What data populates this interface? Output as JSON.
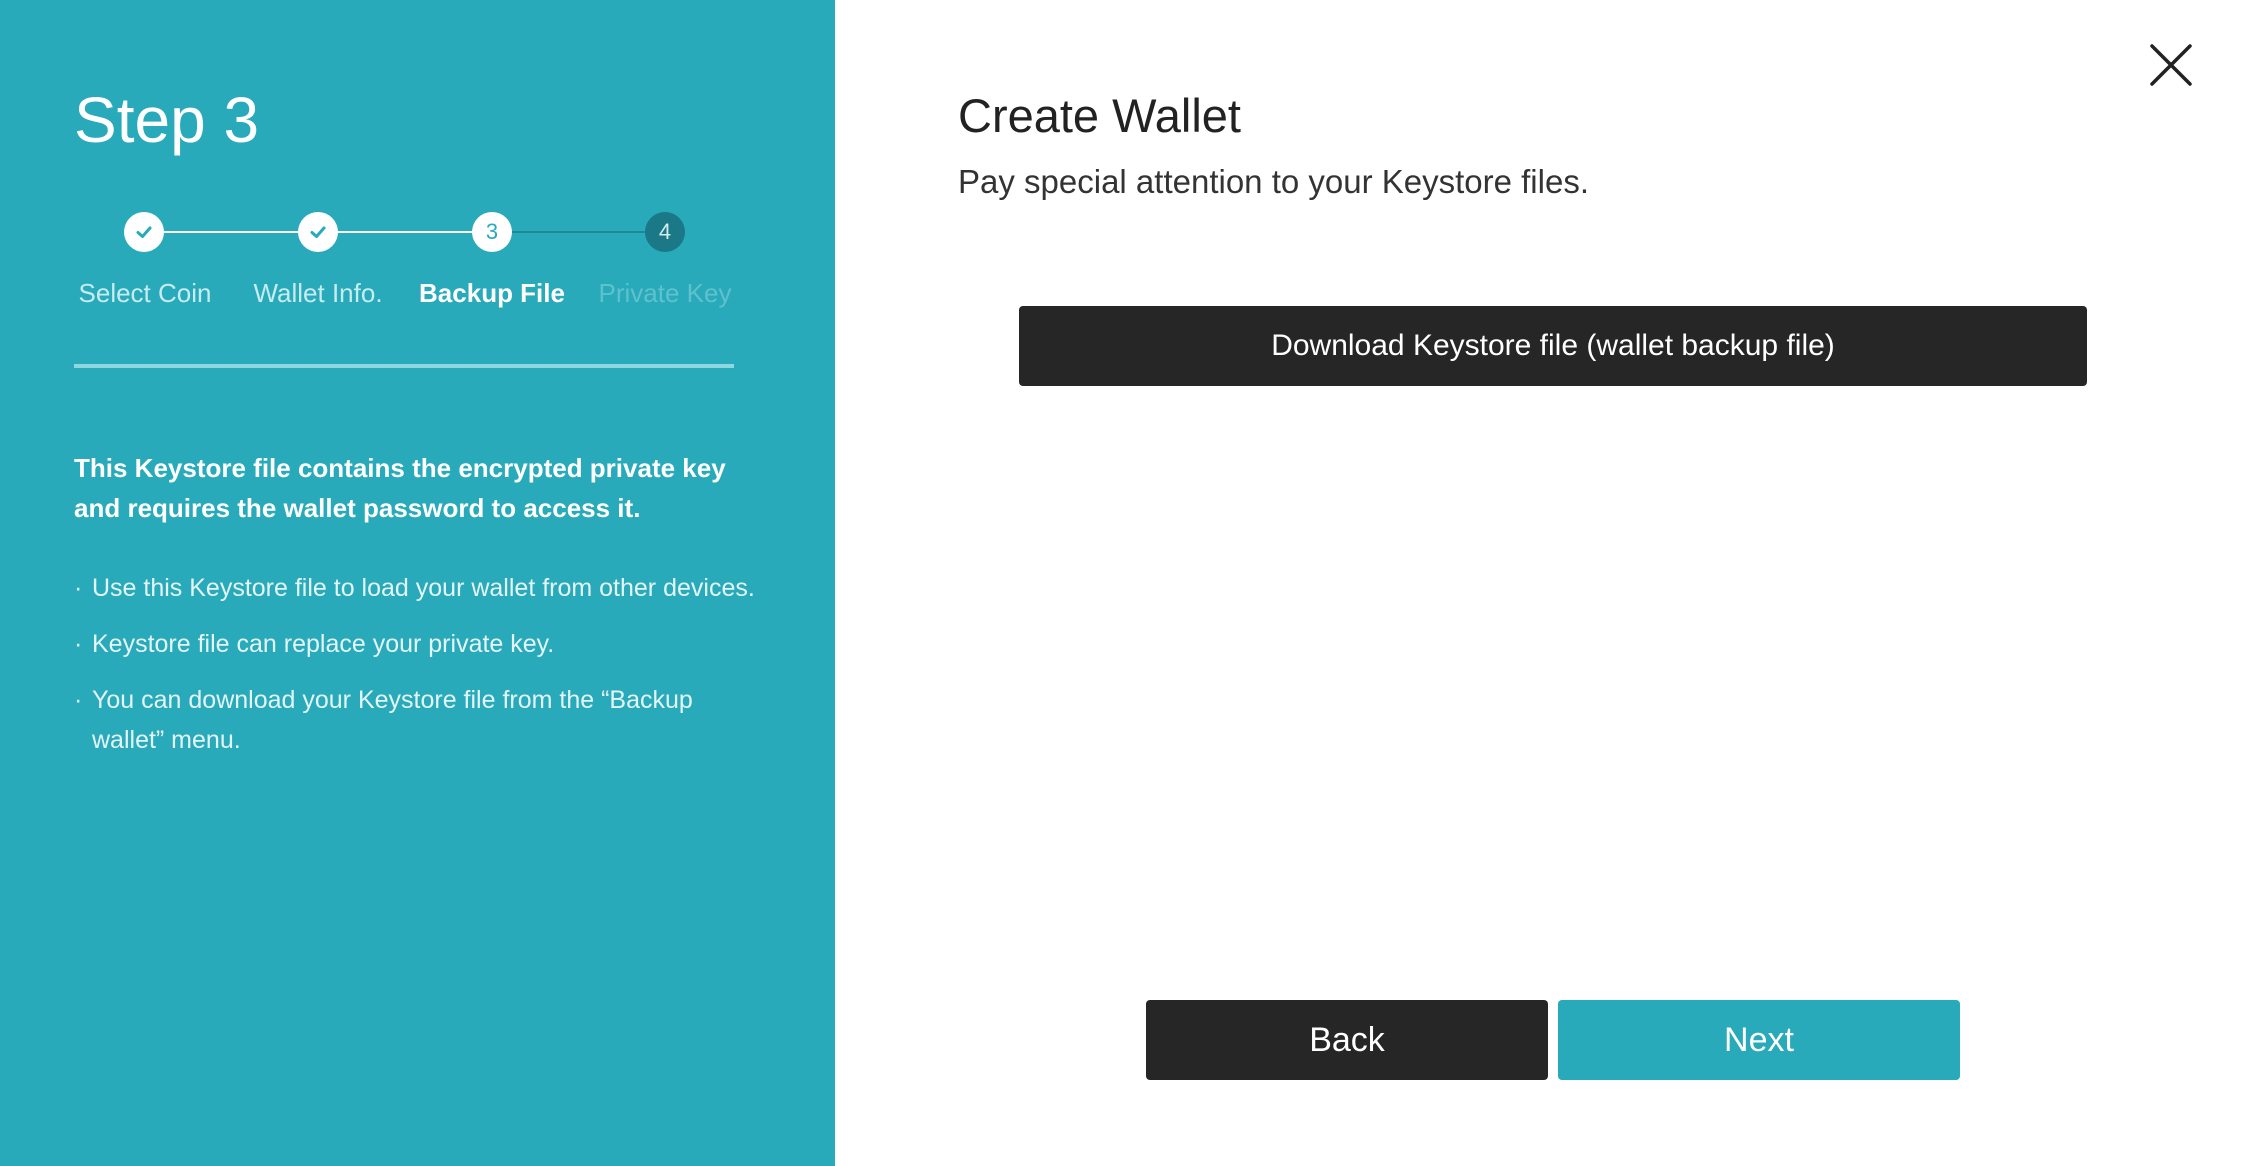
{
  "sidebar": {
    "step_title": "Step 3",
    "steps": [
      {
        "number": "1",
        "label": "Select Coin",
        "status": "complete"
      },
      {
        "number": "2",
        "label": "Wallet Info.",
        "status": "complete"
      },
      {
        "number": "3",
        "label": "Backup File",
        "status": "current"
      },
      {
        "number": "4",
        "label": "Private Key",
        "status": "pending"
      }
    ],
    "info_heading": "This Keystore file contains the encrypted private key and requires the wallet password to access it.",
    "bullet_marker": "·",
    "bullets": [
      "Use this Keystore file to load your wallet from other devices.",
      "Keystore file can replace your private key.",
      "You can download your Keystore file from the “Backup wallet” menu."
    ]
  },
  "main": {
    "title": "Create Wallet",
    "subtitle": "Pay special attention to your Keystore files.",
    "download_button_label": "Download Keystore file (wallet backup file)"
  },
  "footer": {
    "back_label": "Back",
    "next_label": "Next"
  },
  "icons": {
    "close": "close-icon",
    "checkmark": "checkmark-icon"
  },
  "colors": {
    "accent": "#28aabb",
    "dark_button": "#262626",
    "pending_step": "#1a7887"
  }
}
